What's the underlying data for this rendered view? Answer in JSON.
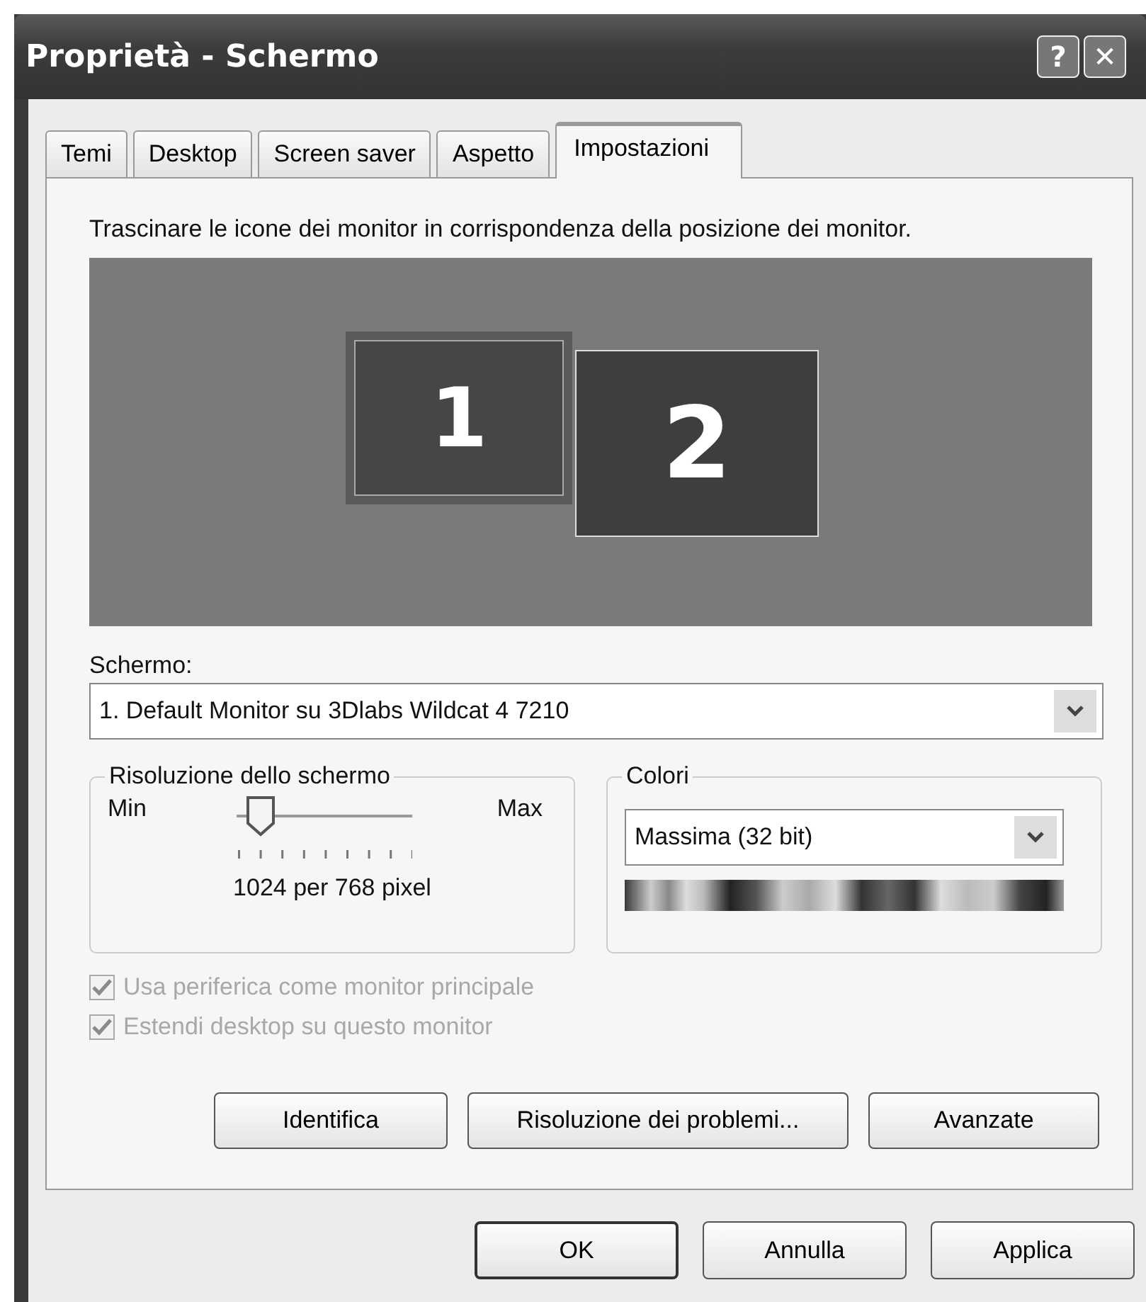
{
  "window": {
    "title": "Proprietà - Schermo",
    "title_buttons": [
      "?",
      "✕"
    ]
  },
  "tabs": [
    {
      "label": "Temi",
      "selected": false
    },
    {
      "label": "Desktop",
      "selected": false
    },
    {
      "label": "Screen saver",
      "selected": false
    },
    {
      "label": "Aspetto",
      "selected": false
    },
    {
      "label": "Impostazioni",
      "selected": true
    }
  ],
  "instruction": "Trascinare le icone dei monitor in corrispondenza della posizione dei monitor.",
  "monitors": [
    {
      "label": "1",
      "selected": true
    },
    {
      "label": "2",
      "selected": false
    }
  ],
  "display": {
    "label": "Schermo:",
    "value": "1. Default Monitor su 3Dlabs Wildcat  4  7210"
  },
  "resolution": {
    "title": "Risoluzione dello schermo",
    "min_label": "Min",
    "max_label": "Max",
    "level": 0.125,
    "reading": "1024 per 768 pixel"
  },
  "colors": {
    "title": "Colori",
    "value": "Massima (32 bit)"
  },
  "checkboxes": [
    {
      "label": "Usa periferica come monitor principale",
      "checked": true,
      "disabled": true
    },
    {
      "label": "Estendi desktop su questo monitor",
      "checked": true,
      "disabled": true
    }
  ],
  "panel_buttons": [
    "Identifica",
    "Risoluzione dei problemi...",
    "Avanzate"
  ],
  "dialog_buttons": [
    {
      "label": "OK",
      "default": true
    },
    {
      "label": "Annulla",
      "default": false
    },
    {
      "label": "Applica",
      "default": false
    }
  ]
}
